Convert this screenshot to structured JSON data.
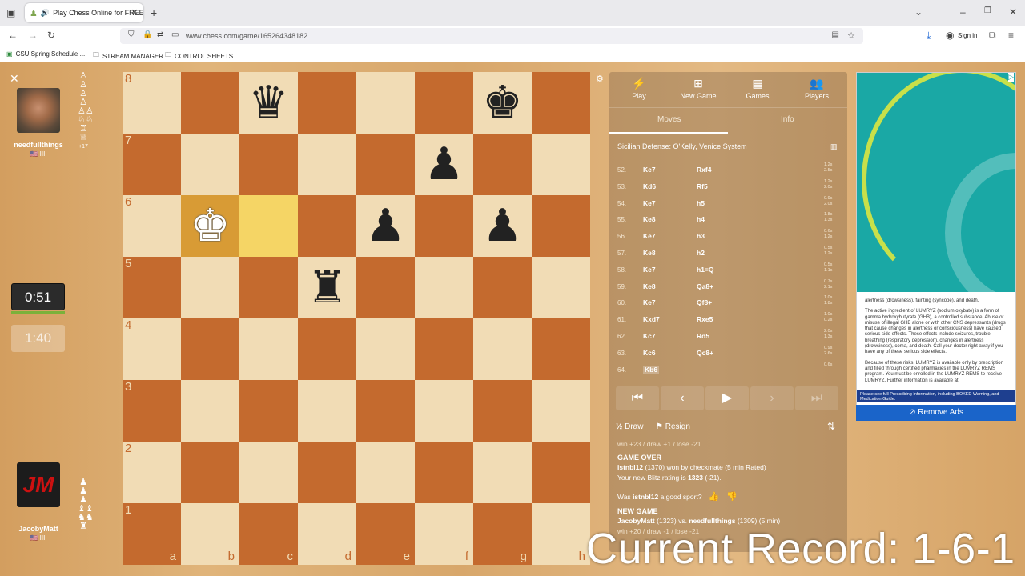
{
  "browser": {
    "tab_title": "Play Chess Online for FREE",
    "url": "www.chess.com/game/165264348182",
    "sign_in": "Sign in",
    "bookmarks": [
      "CSU Spring Schedule ...",
      "STREAM MANAGER",
      "CONTROL SHEETS"
    ]
  },
  "players": {
    "top": {
      "name": "needfullthings",
      "flag": "🇺🇸 IIII",
      "clock": "1:40",
      "captured_extra": "+17"
    },
    "bottom": {
      "name": "JacobyMatt",
      "flag": "🇺🇸 IIII",
      "clock": "0:51"
    }
  },
  "board": {
    "ranks": [
      "8",
      "7",
      "6",
      "5",
      "4",
      "3",
      "2",
      "1"
    ],
    "files": [
      "a",
      "b",
      "c",
      "d",
      "e",
      "f",
      "g",
      "h"
    ],
    "pieces": [
      {
        "square": "c8",
        "glyph": "♛",
        "color": "black"
      },
      {
        "square": "g8",
        "glyph": "♚",
        "color": "black"
      },
      {
        "square": "f7",
        "glyph": "♟",
        "color": "black"
      },
      {
        "square": "b6",
        "glyph": "♚",
        "color": "white"
      },
      {
        "square": "e6",
        "glyph": "♟",
        "color": "black"
      },
      {
        "square": "g6",
        "glyph": "♟",
        "color": "black"
      },
      {
        "square": "d5",
        "glyph": "♜",
        "color": "black"
      }
    ],
    "highlight": [
      "b6",
      "c6"
    ]
  },
  "panel": {
    "tabs": [
      {
        "label": "Play",
        "icon": "bolt-icon"
      },
      {
        "label": "New Game",
        "icon": "plus-icon"
      },
      {
        "label": "Games",
        "icon": "grid-icon"
      },
      {
        "label": "Players",
        "icon": "players-icon"
      }
    ],
    "subtabs": [
      "Moves",
      "Info"
    ],
    "opening": "Sicilian Defense: O'Kelly, Venice System",
    "moves": [
      {
        "n": "52.",
        "w": "Ke7",
        "b": "Rxf4",
        "t1": "1.2s",
        "t2": "2.5s"
      },
      {
        "n": "53.",
        "w": "Kd6",
        "b": "Rf5",
        "t1": "1.2s",
        "t2": "2.0s"
      },
      {
        "n": "54.",
        "w": "Ke7",
        "b": "h5",
        "t1": "0.9s",
        "t2": "2.0s"
      },
      {
        "n": "55.",
        "w": "Ke8",
        "b": "h4",
        "t1": "1.8s",
        "t2": "1.3s"
      },
      {
        "n": "56.",
        "w": "Ke7",
        "b": "h3",
        "t1": "0.6s",
        "t2": "1.2s"
      },
      {
        "n": "57.",
        "w": "Ke8",
        "b": "h2",
        "t1": "0.5s",
        "t2": "1.2s"
      },
      {
        "n": "58.",
        "w": "Ke7",
        "b": "h1=Q",
        "t1": "0.5s",
        "t2": "1.1s"
      },
      {
        "n": "59.",
        "w": "Ke8",
        "b": "Qa8+",
        "t1": "0.7s",
        "t2": "2.1s"
      },
      {
        "n": "60.",
        "w": "Ke7",
        "b": "Qf8+",
        "t1": "1.0s",
        "t2": "1.8s"
      },
      {
        "n": "61.",
        "w": "Kxd7",
        "b": "Rxe5",
        "t1": "1.0s",
        "t2": "0.2s"
      },
      {
        "n": "62.",
        "w": "Kc7",
        "b": "Rd5",
        "t1": "2.0s",
        "t2": "1.3s"
      },
      {
        "n": "63.",
        "w": "Kc6",
        "b": "Qc8+",
        "t1": "0.9s",
        "t2": "2.6s"
      },
      {
        "n": "64.",
        "w": "Kb6",
        "b": "",
        "t1": "0.6s",
        "t2": ""
      }
    ],
    "draw": "Draw",
    "resign": "Resign",
    "stakes1": "win +23 / draw +1 / lose -21",
    "game_over_title": "GAME OVER",
    "winner": "istnbl12",
    "winner_rating": "(1370)",
    "won_by": "won by checkmate (5 min Rated)",
    "new_rating_prefix": "Your new Blitz rating is",
    "new_rating": "1323",
    "new_rating_delta": "(-21).",
    "sport_prefix": "Was",
    "sport_name": "istnbl12",
    "sport_suffix": "a good sport?",
    "new_game_title": "NEW GAME",
    "ng_p1": "JacobyMatt",
    "ng_p1_rating": "(1323)",
    "ng_vs": "vs.",
    "ng_p2": "needfullthings",
    "ng_p2_rating": "(1309)",
    "ng_mode": "(5 min)",
    "stakes2": "win +20 / draw -1 / lose -21"
  },
  "ad": {
    "p1": "alertness (drowsiness), fainting (syncope), and death.",
    "p2": "The active ingredient of LUMRYZ (sodium oxybate) is a form of gamma hydroxybutyrate (GHB), a controlled substance. Abuse or misuse of illegal GHB alone or with other CNS depressants (drugs that cause changes in alertness or consciousness) have caused serious side effects. These effects include seizures, trouble breathing (respiratory depression), changes in alertness (drowsiness), coma, and death. Call your doctor right away if you have any of these serious side effects.",
    "p3": "Because of these risks, LUMRYZ is available only by prescription and filled through certified pharmacies in the LUMRYZ REMS program. You must be enrolled in the LUMRYZ REMS to receive LUMRYZ. Further information is available at",
    "footer": "Please see full Prescribing Information, including BOXED Warning, and Medication Guide.",
    "remove": "Remove Ads"
  },
  "overlay": {
    "record": "Current Record: 1-6-1"
  }
}
